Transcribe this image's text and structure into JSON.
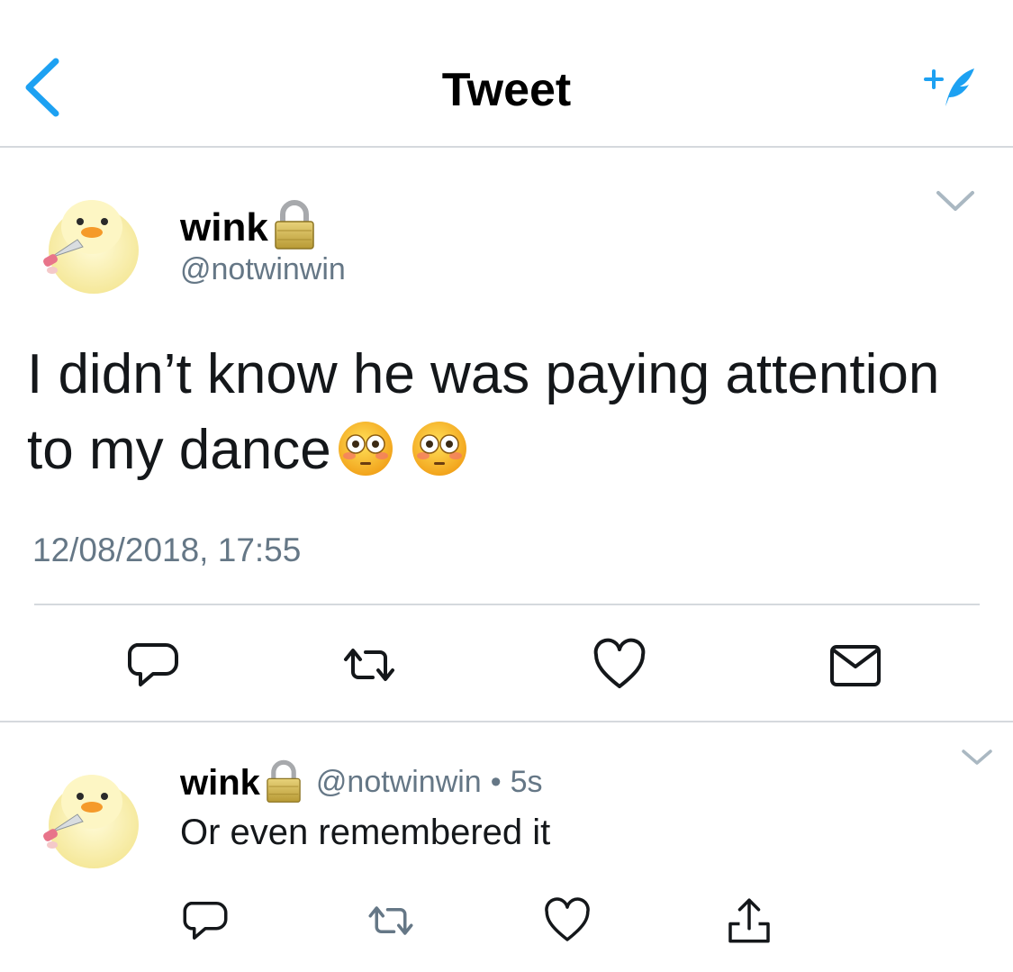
{
  "navbar": {
    "title": "Tweet",
    "back_icon": "chevron-left-icon",
    "compose_icon": "compose-tweet-icon",
    "accent_color": "#1da1f2"
  },
  "main_tweet": {
    "display_name": "wink",
    "protected_icon": "lock-icon",
    "handle": "@notwinwin",
    "text": "I didn’t know he was paying attention to my dance",
    "emojis": [
      "flushed-face-emoji",
      "flushed-face-emoji"
    ],
    "timestamp": "12/08/2018, 17:55",
    "actions": [
      "reply-icon",
      "retweet-icon",
      "like-icon",
      "direct-message-icon"
    ]
  },
  "reply_tweet": {
    "display_name": "wink",
    "protected_icon": "lock-icon",
    "handle": "@notwinwin",
    "separator": "•",
    "time_ago": "5s",
    "text": "Or even remembered it",
    "actions": [
      "reply-icon",
      "retweet-icon",
      "like-icon",
      "share-icon"
    ]
  },
  "colors": {
    "text_primary": "#14171a",
    "text_secondary": "#657786",
    "divider": "#d5d9dd",
    "icon_gray": "#657786"
  }
}
